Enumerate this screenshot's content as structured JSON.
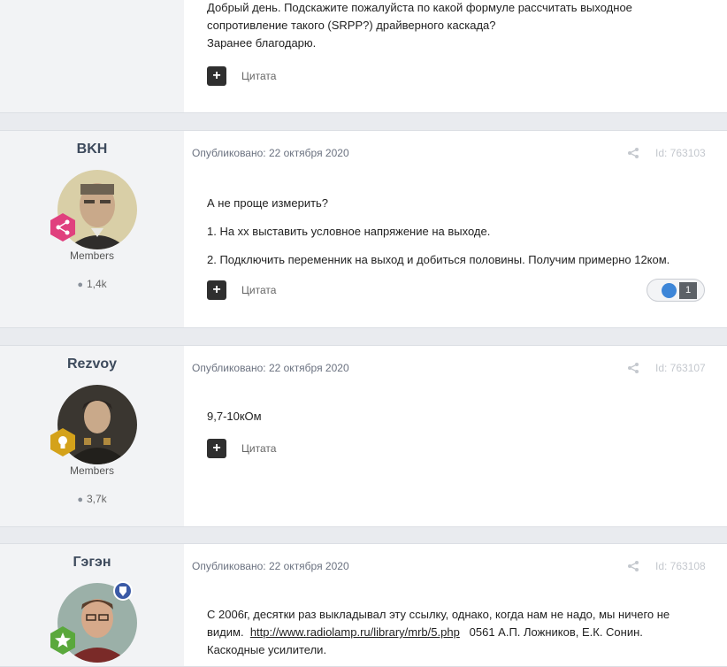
{
  "posts": [
    {
      "content": [
        "Добрый день. Подскажите пожалуйста по какой формуле рассчитать выходное сопротивление такого (SRPP?) драйверного каскада?",
        "Заранее благодарю."
      ],
      "quote_label": "Цитата"
    },
    {
      "author": "BKH",
      "group": "Members",
      "count": "1,4k",
      "meta": "Опубликовано: 22 октября 2020",
      "id_label": "Id: 763103",
      "content": [
        "А не проще измерить?",
        "1. На хх выставить условное напряжение на выходе.",
        "2. Подключить переменник на выход и добиться половины. Получим примерно 12ком."
      ],
      "quote_label": "Цитата",
      "reaction_count": "1"
    },
    {
      "author": "Rezvoy",
      "group": "Members",
      "count": "3,7k",
      "meta": "Опубликовано: 22 октября 2020",
      "id_label": "Id: 763107",
      "content": [
        "9,7-10кОм"
      ],
      "quote_label": "Цитата"
    },
    {
      "author": "Гэгэн",
      "meta": "Опубликовано: 22 октября 2020",
      "id_label": "Id: 763108",
      "content_line1": "С 2006г, десятки раз выкладывал эту ссылку, однако, когда нам не надо, мы ничего не",
      "content_line2_prefix": "видим.",
      "content_link": "http://www.radiolamp.ru/library/mrb/5.php",
      "content_line2_suffix": "0561 А.П. Ложников, Е.К. Сонин.",
      "content_line3": "Каскодные усилители."
    }
  ],
  "icons": {
    "plus": "plus-icon",
    "comment": "comment-icon",
    "share": "share-icon",
    "like": "thumbs-up-icon",
    "badge_share": "share-badge-icon",
    "badge_bulb": "lightbulb-badge-icon",
    "badge_star": "star-badge-icon",
    "moderator": "shield-icon"
  },
  "colors": {
    "badge_pink": "#e0407e",
    "badge_gold": "#d4a21a",
    "badge_green": "#5aa83c",
    "shield_blue": "#3b5aa6",
    "like_blue": "#3d86d8"
  }
}
